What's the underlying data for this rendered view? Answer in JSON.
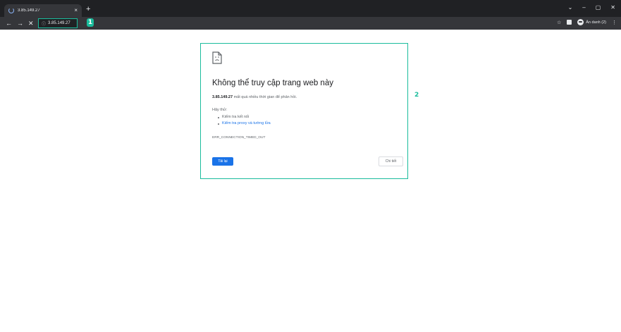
{
  "tab": {
    "title": "3.85.149.27",
    "close": "×",
    "new_tab": "+"
  },
  "window_controls": {
    "dropdown": "⌄",
    "minimize": "–",
    "maximize": "▢",
    "close": "✕"
  },
  "toolbar": {
    "back": "←",
    "forward": "→",
    "stop": "✕",
    "address": "3.85.149.27",
    "address_icon": "info-circle-icon",
    "bookmark": "☆",
    "profile_label": "Ẩn danh (2)",
    "menu": "⋮"
  },
  "markers": {
    "one": "1",
    "two": "2"
  },
  "error_page": {
    "title": "Không thể truy cập trang web này",
    "host": "3.85.149.27",
    "message_suffix": " mất quá nhiều thời gian để phản hồi.",
    "try_label": "Hãy thử:",
    "suggestions": [
      {
        "text": "Kiểm tra kết nối",
        "is_link": false
      },
      {
        "text": "Kiểm tra proxy và tường lửa",
        "is_link": true
      }
    ],
    "error_code": "ERR_CONNECTION_TIMED_OUT",
    "reload_label": "Tải lại",
    "details_label": "Chi tiết"
  },
  "colors": {
    "highlight": "#1abc9c",
    "primary_button": "#1a73e8",
    "chrome_dark": "#202124"
  }
}
